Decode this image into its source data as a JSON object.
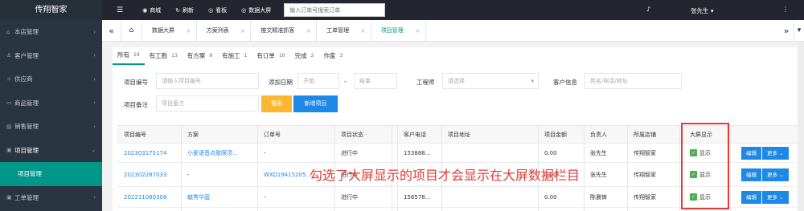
{
  "app": {
    "title": "传翔智家"
  },
  "sidebar": {
    "items": [
      {
        "label": "本店管理",
        "icon": "home-icon"
      },
      {
        "label": "客户管理",
        "icon": "user-icon"
      },
      {
        "label": "供应商",
        "icon": "bulb-icon"
      },
      {
        "label": "商品管理",
        "icon": "cart-icon"
      },
      {
        "label": "销售管理",
        "icon": "chart-icon"
      },
      {
        "label": "项目管理",
        "icon": "doc-icon"
      },
      {
        "label": "项目管理",
        "icon": ""
      },
      {
        "label": "工单管理",
        "icon": "doc-icon"
      }
    ]
  },
  "topbar": {
    "menu_icon": "☰",
    "shop": "商城",
    "refresh": "刷新",
    "board": "看板",
    "bigscreen": "数据大屏",
    "search_placeholder": "输入订单号搜索订单",
    "user": "张先生"
  },
  "tabs": [
    {
      "label": "数据大屏"
    },
    {
      "label": "方案列表"
    },
    {
      "label": "推文精准抓客"
    },
    {
      "label": "工单管理"
    },
    {
      "label": "项目管理",
      "active": true
    }
  ],
  "filter_tabs": [
    {
      "label": "所有",
      "count": "19"
    },
    {
      "label": "有工勘",
      "count": "13"
    },
    {
      "label": "有方案",
      "count": "9"
    },
    {
      "label": "有施工",
      "count": "1"
    },
    {
      "label": "有订单",
      "count": "10"
    },
    {
      "label": "完成",
      "count": "2"
    },
    {
      "label": "作废",
      "count": "3"
    }
  ],
  "form": {
    "project_no_label": "项目编号",
    "project_no_placeholder": "请输入项目编号",
    "date_label": "添加日期",
    "date_start": "开始",
    "date_sep": "-",
    "date_end": "结束",
    "engineer_label": "工程师",
    "engineer_placeholder": "请选择",
    "customer_label": "客户信息",
    "customer_placeholder": "姓名/电话/地址",
    "note_label": "项目备注",
    "note_placeholder": "项目备注",
    "search_button": "搜索",
    "add_button": "新增项目"
  },
  "table": {
    "headers": [
      "项目编号",
      "方案",
      "订单号",
      "项目状态",
      "客户电话",
      "项目地址",
      "项目金额",
      "负责人",
      "所属店铺",
      "大屏显示"
    ],
    "rows": [
      {
        "no": "202303175174",
        "plan": "小爱语音点歌限顶...",
        "order": "-",
        "status": "进行中",
        "phone": "153888...",
        "address": "",
        "amount": "0.00",
        "owner": "张先生",
        "store": "传翔智家",
        "display": "显示",
        "edit": "编辑",
        "more": "更多"
      },
      {
        "no": "202302287033",
        "plan": "-",
        "order": "WXO19415205...",
        "status": "进行中",
        "phone": "...",
        "address": "",
        "amount": "0.00",
        "owner": "张先生",
        "store": "传翔智家",
        "display": "显示",
        "edit": "编辑",
        "more": "更多"
      },
      {
        "no": "202211080308",
        "plan": "毓秀华庭",
        "order": "-",
        "status": "进行中",
        "phone": "158578...",
        "address": "",
        "amount": "0.00",
        "owner": "陈晨锋",
        "store": "传翔智家",
        "display": "显示",
        "edit": "编辑",
        "more": "更多"
      }
    ]
  },
  "annotation": "勾选了大屏显示的项目才会显示在大屏数据栏目",
  "colors": {
    "accent": "#009688",
    "primary": "#1e88e5",
    "annotation": "#e53935",
    "warning": "#fbb731"
  }
}
